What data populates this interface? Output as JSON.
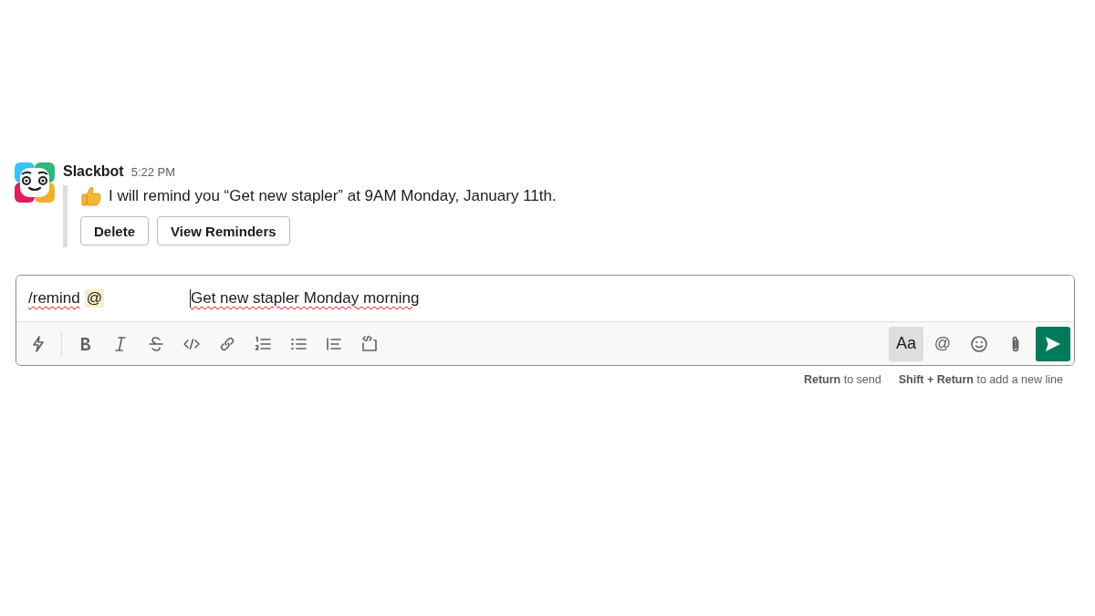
{
  "message": {
    "author": "Slackbot",
    "time": "5:22 PM",
    "text": "I will remind you “Get new stapler” at 9AM Monday, January 11th.",
    "buttons": [
      "Delete",
      "View Reminders"
    ]
  },
  "composer": {
    "segments": [
      {
        "kind": "word",
        "text": "/remind"
      },
      {
        "kind": "mention",
        "text": "@"
      },
      {
        "kind": "gap"
      },
      {
        "kind": "word",
        "text": "Get new stapler Monday morning",
        "caret": true
      }
    ],
    "toolbar_left": [
      {
        "kind": "shortcut"
      },
      {
        "kind": "bold"
      },
      {
        "kind": "italic"
      },
      {
        "kind": "strike"
      },
      {
        "kind": "code"
      },
      {
        "kind": "link"
      },
      {
        "kind": "ordered"
      },
      {
        "kind": "bullets"
      },
      {
        "kind": "quote"
      },
      {
        "kind": "codeblock"
      }
    ],
    "toolbar_right": [
      {
        "kind": "text",
        "text": "Aa",
        "selected": true
      },
      {
        "kind": "text",
        "text": "@",
        "selected": false
      },
      {
        "kind": "emoji",
        "selected": false
      },
      {
        "kind": "attach",
        "selected": false
      },
      {
        "kind": "send",
        "selected": false
      }
    ]
  },
  "hints": [
    "**Return** to send",
    "**Shift + Return** to add a new line"
  ]
}
